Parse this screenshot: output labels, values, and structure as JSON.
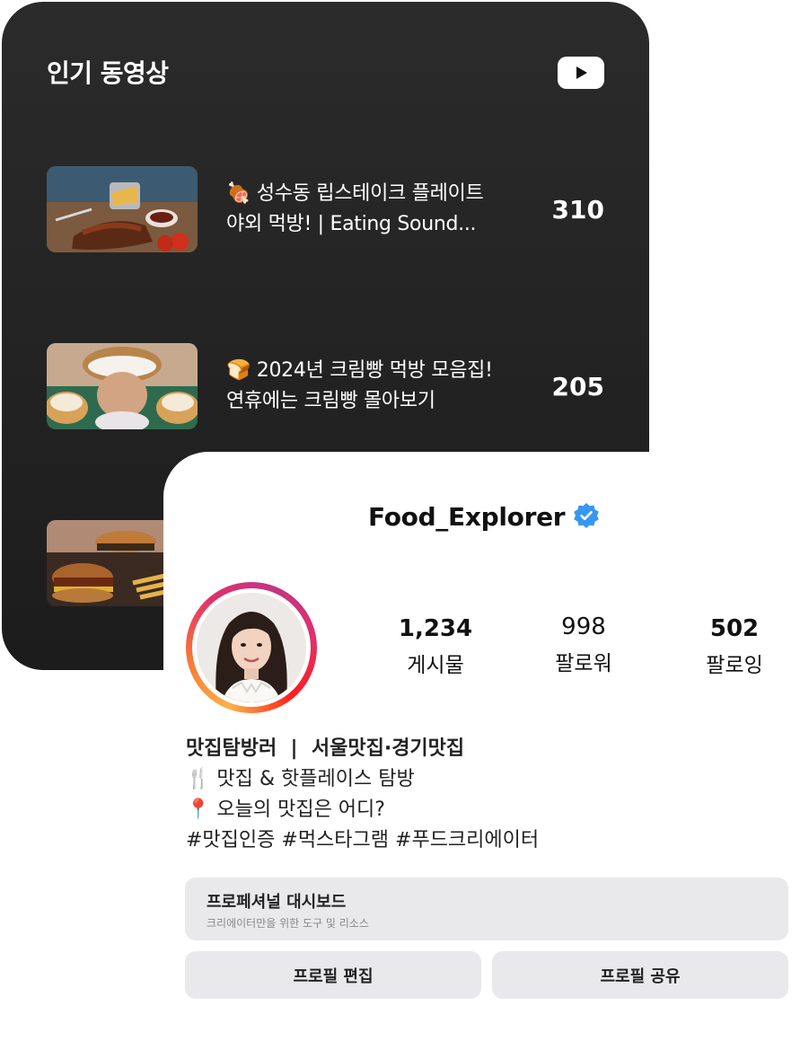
{
  "popular_videos": {
    "title": "인기 동영상",
    "platform_icon": "youtube-icon",
    "videos": [
      {
        "title": "🍖 성수동 립스테이크 플레이트\n야외 먹방! | Eating Sound...",
        "count": "310",
        "thumbnail": "ribs-steak-plate"
      },
      {
        "title": "🍞 2024년 크림빵 먹방 모음집!\n연휴에는 크림빵 몰아보기",
        "count": "205",
        "thumbnail": "cream-bread"
      },
      {
        "title": "",
        "count": "",
        "thumbnail": "burger-fries"
      }
    ]
  },
  "profile": {
    "username": "Food_Explorer",
    "verified_icon": "verified-badge-icon",
    "stats": [
      {
        "value": "1,234",
        "label": "게시물"
      },
      {
        "value": "998",
        "label": "팔로워"
      },
      {
        "value": "502",
        "label": "팔로잉"
      }
    ],
    "bio": {
      "headline": "맛집탐방러  |  서울맛집·경기맛집",
      "lines": [
        "🍴 맛집 & 핫플레이스 탐방",
        "📍 오늘의 맛집은 어디?",
        "#맛집인증 #먹스타그램 #푸드크리에이터"
      ]
    },
    "dashboard": {
      "title": "프로페셔널 대시보드",
      "subtitle": "크리에이터만을 위한 도구 및 리소스"
    },
    "buttons": {
      "edit": "프로필 편집",
      "share": "프로필 공유"
    }
  },
  "colors": {
    "dark_card": "#222222",
    "verified": "#3797f0",
    "button_bg": "#e9e9ec"
  }
}
